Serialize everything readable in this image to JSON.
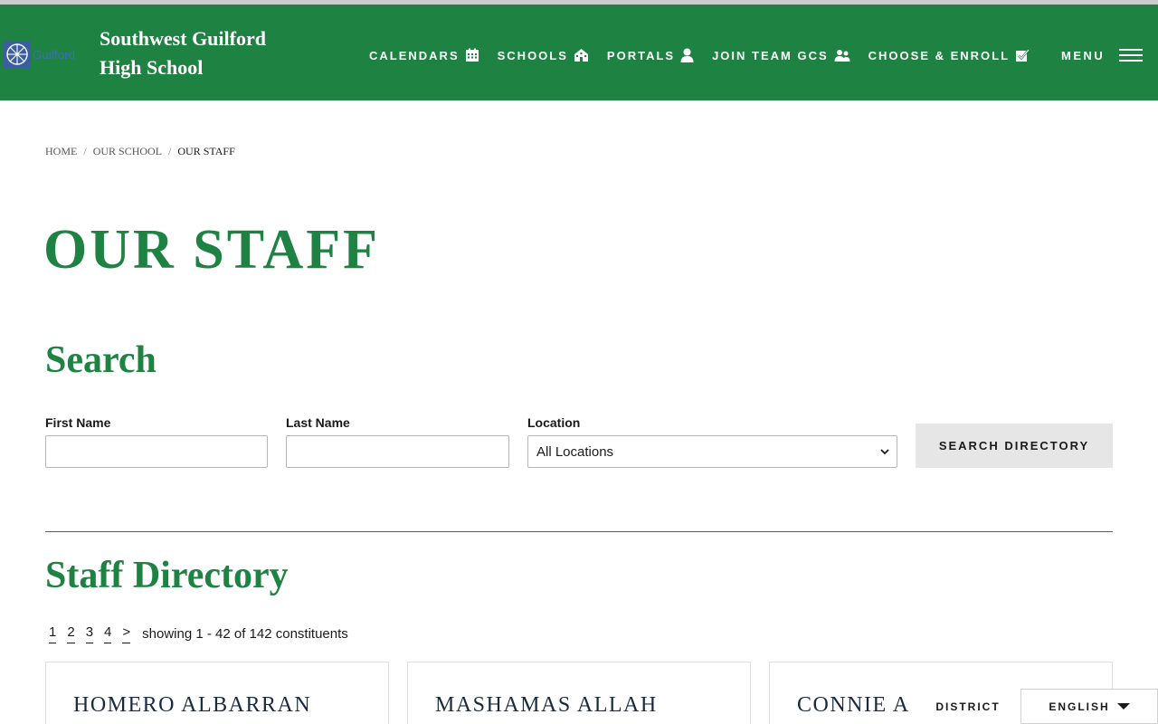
{
  "header": {
    "logo_text": "Guilford",
    "school_name_line1": "Southwest Guilford",
    "school_name_line2": "High School",
    "nav": [
      {
        "label": "CALENDARS",
        "icon": "calendar-icon"
      },
      {
        "label": "SCHOOLS",
        "icon": "school-building-icon"
      },
      {
        "label": "PORTALS",
        "icon": "user-icon"
      },
      {
        "label": "JOIN TEAM GCS",
        "icon": "users-icon"
      },
      {
        "label": "CHOOSE & ENROLL",
        "icon": "checkbox-icon"
      }
    ],
    "menu_label": "MENU"
  },
  "breadcrumb": {
    "items": [
      "HOME",
      "OUR SCHOOL",
      "OUR STAFF"
    ]
  },
  "page_title": "OUR STAFF",
  "search": {
    "heading": "Search",
    "first_name_label": "First Name",
    "first_name_value": "",
    "last_name_label": "Last Name",
    "last_name_value": "",
    "location_label": "Location",
    "location_selected": "All Locations",
    "button_label": "SEARCH DIRECTORY"
  },
  "directory": {
    "heading": "Staff Directory",
    "pages": [
      "1",
      "2",
      "3",
      "4",
      ">"
    ],
    "showing_text": "showing 1 - 42 of 142 constituents",
    "cards": [
      {
        "name": "HOMERO ALBARRAN"
      },
      {
        "name": "MASHAMAS ALLAH"
      },
      {
        "name": "CONNIE A"
      }
    ]
  },
  "footer_bar": {
    "district_label": "DISTRICT",
    "language_label": "ENGLISH"
  },
  "colors": {
    "brand_green": "#1e8342",
    "button_gray": "#e6e6e6"
  }
}
